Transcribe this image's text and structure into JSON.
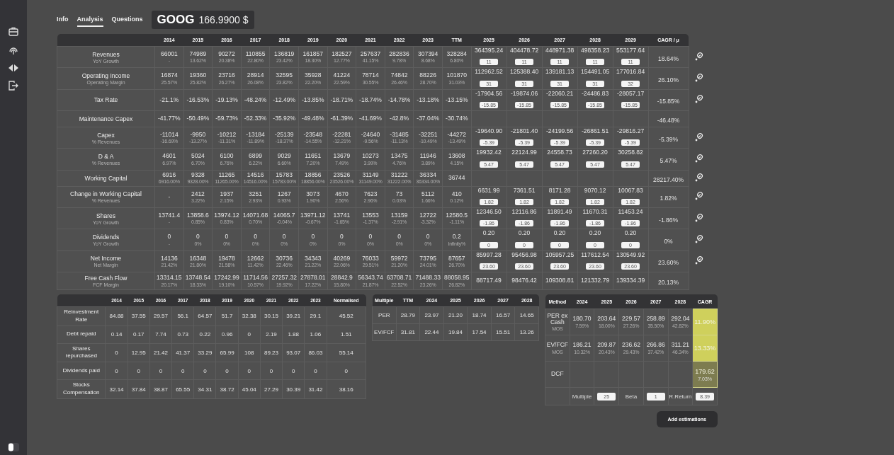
{
  "tabs": [
    {
      "label": "Info",
      "selected": false
    },
    {
      "label": "Analysis",
      "selected": true
    },
    {
      "label": "Questions",
      "selected": false
    }
  ],
  "quote": {
    "ticker": "GOOG",
    "price": "166.9900 $"
  },
  "main_table": {
    "history_columns": [
      "2014",
      "2015",
      "2016",
      "2017",
      "2018",
      "2019",
      "2020",
      "2021",
      "2022",
      "2023",
      "TTM"
    ],
    "forecast_columns": [
      "2025",
      "2026",
      "2027",
      "2028",
      "2029"
    ],
    "cagr_column": "CAGR / μ",
    "rows": [
      {
        "label": "Revenues",
        "sublabel": "YoY Growth",
        "history": [
          {
            "value": "66001",
            "sub": "-"
          },
          {
            "value": "74989",
            "sub": "13.62%"
          },
          {
            "value": "90272",
            "sub": "20.38%"
          },
          {
            "value": "110855",
            "sub": "22.80%"
          },
          {
            "value": "136819",
            "sub": "23.42%"
          },
          {
            "value": "161857",
            "sub": "18.30%"
          },
          {
            "value": "182527",
            "sub": "12.77%"
          },
          {
            "value": "257637",
            "sub": "41.15%"
          },
          {
            "value": "282836",
            "sub": "9.78%"
          },
          {
            "value": "307394",
            "sub": "8.68%"
          },
          {
            "value": "328284",
            "sub": "6.80%"
          }
        ],
        "forecast": [
          {
            "value": "364395.24",
            "input": "11"
          },
          {
            "value": "404478.72",
            "input": "11"
          },
          {
            "value": "448971.38",
            "input": "11"
          },
          {
            "value": "498358.23",
            "input": "11"
          },
          {
            "value": "553177.64",
            "input": "11"
          }
        ],
        "cagr": "18.64%",
        "editable": true
      },
      {
        "label": "Operating Income",
        "sublabel": "Operating Margin",
        "history": [
          {
            "value": "16874",
            "sub": "25.57%"
          },
          {
            "value": "19360",
            "sub": "25.82%"
          },
          {
            "value": "23716",
            "sub": "26.27%"
          },
          {
            "value": "28914",
            "sub": "26.08%"
          },
          {
            "value": "32595",
            "sub": "23.82%"
          },
          {
            "value": "35928",
            "sub": "22.20%"
          },
          {
            "value": "41224",
            "sub": "22.59%"
          },
          {
            "value": "78714",
            "sub": "30.55%"
          },
          {
            "value": "74842",
            "sub": "26.46%"
          },
          {
            "value": "88226",
            "sub": "28.70%"
          },
          {
            "value": "101870",
            "sub": "31.03%"
          }
        ],
        "forecast": [
          {
            "value": "112962.52",
            "input": "31"
          },
          {
            "value": "125388.40",
            "input": "31"
          },
          {
            "value": "139181.13",
            "input": "31"
          },
          {
            "value": "154491.05",
            "input": "31"
          },
          {
            "value": "177016.84",
            "input": "32"
          }
        ],
        "cagr": "26.10%",
        "editable": true
      },
      {
        "label": "Tax Rate",
        "history": [
          {
            "value": "-21.1%"
          },
          {
            "value": "-16.53%"
          },
          {
            "value": "-19.13%"
          },
          {
            "value": "-48.24%"
          },
          {
            "value": "-12.49%"
          },
          {
            "value": "-13.85%"
          },
          {
            "value": "-18.71%"
          },
          {
            "value": "-18.74%"
          },
          {
            "value": "-14.78%"
          },
          {
            "value": "-13.18%"
          },
          {
            "value": "-13.15%"
          }
        ],
        "forecast": [
          {
            "value": "-17904.56",
            "input": "-15.85"
          },
          {
            "value": "-19874.06",
            "input": "-15.85"
          },
          {
            "value": "-22060.21",
            "input": "-15.85"
          },
          {
            "value": "-24486.83",
            "input": "-15.85"
          },
          {
            "value": "-28057.17",
            "input": "-15.85"
          }
        ],
        "cagr": "-15.85%",
        "editable": true
      },
      {
        "label": "Maintenance Capex",
        "history": [
          {
            "value": "-41.77%"
          },
          {
            "value": "-50.49%"
          },
          {
            "value": "-59.73%"
          },
          {
            "value": "-52.33%"
          },
          {
            "value": "-35.92%"
          },
          {
            "value": "-49.48%"
          },
          {
            "value": "-61.39%"
          },
          {
            "value": "-41.69%"
          },
          {
            "value": "-42.8%"
          },
          {
            "value": "-37.04%"
          },
          {
            "value": "-30.74%"
          }
        ],
        "cagr": "-46.48%",
        "editable": false
      },
      {
        "label": "Capex",
        "sublabel": "% Revenues",
        "history": [
          {
            "value": "-11014",
            "sub": "-16.69%"
          },
          {
            "value": "-9950",
            "sub": "-13.27%"
          },
          {
            "value": "-10212",
            "sub": "-11.31%"
          },
          {
            "value": "-13184",
            "sub": "-11.89%"
          },
          {
            "value": "-25139",
            "sub": "-18.37%"
          },
          {
            "value": "-23548",
            "sub": "-14.55%"
          },
          {
            "value": "-22281",
            "sub": "-12.21%"
          },
          {
            "value": "-24640",
            "sub": "-9.56%"
          },
          {
            "value": "-31485",
            "sub": "-11.13%"
          },
          {
            "value": "-32251",
            "sub": "-10.49%"
          },
          {
            "value": "-44272",
            "sub": "-13.49%"
          }
        ],
        "forecast": [
          {
            "value": "-19640.90",
            "input": "-5.39"
          },
          {
            "value": "-21801.40",
            "input": "-5.39"
          },
          {
            "value": "-24199.56",
            "input": "-5.39"
          },
          {
            "value": "-26861.51",
            "input": "-5.39"
          },
          {
            "value": "-29816.27",
            "input": "-5.39"
          }
        ],
        "cagr": "-5.39%",
        "editable": true
      },
      {
        "label": "D & A",
        "sublabel": "% Revenues",
        "history": [
          {
            "value": "4601",
            "sub": "6.97%"
          },
          {
            "value": "5024",
            "sub": "6.70%"
          },
          {
            "value": "6100",
            "sub": "6.76%"
          },
          {
            "value": "6899",
            "sub": "6.22%"
          },
          {
            "value": "9029",
            "sub": "6.60%"
          },
          {
            "value": "11651",
            "sub": "7.20%"
          },
          {
            "value": "13679",
            "sub": "7.49%"
          },
          {
            "value": "10273",
            "sub": "3.99%"
          },
          {
            "value": "13475",
            "sub": "4.76%"
          },
          {
            "value": "11946",
            "sub": "3.89%"
          },
          {
            "value": "13608",
            "sub": "4.15%"
          }
        ],
        "forecast": [
          {
            "value": "19932.42",
            "input": "5.47"
          },
          {
            "value": "22124.99",
            "input": "5.47"
          },
          {
            "value": "24558.73",
            "input": "5.47"
          },
          {
            "value": "27260.20",
            "input": "5.47"
          },
          {
            "value": "30258.82",
            "input": "5.47"
          }
        ],
        "cagr": "5.47%",
        "editable": true
      },
      {
        "label": "Working Capital",
        "history": [
          {
            "value": "6916",
            "sub": "6916.00%"
          },
          {
            "value": "9328",
            "sub": "9328.00%"
          },
          {
            "value": "11265",
            "sub": "11265.00%"
          },
          {
            "value": "14516",
            "sub": "14516.00%"
          },
          {
            "value": "15783",
            "sub": "15783.00%"
          },
          {
            "value": "18856",
            "sub": "18856.00%"
          },
          {
            "value": "23526",
            "sub": "23526.00%"
          },
          {
            "value": "31149",
            "sub": "31149.00%"
          },
          {
            "value": "31222",
            "sub": "31222.00%"
          },
          {
            "value": "36334",
            "sub": "36334.00%"
          },
          {
            "value": "36744"
          }
        ],
        "cagr": "28217.40%",
        "editable": true
      },
      {
        "label": "Change in Working Capital",
        "sublabel": "% Revenues",
        "history": [
          {
            "value": "-"
          },
          {
            "value": "2412",
            "sub": "3.22%"
          },
          {
            "value": "1937",
            "sub": "2.15%"
          },
          {
            "value": "3251",
            "sub": "2.93%"
          },
          {
            "value": "1267",
            "sub": "0.93%"
          },
          {
            "value": "3073",
            "sub": "1.90%"
          },
          {
            "value": "4670",
            "sub": "2.56%"
          },
          {
            "value": "7623",
            "sub": "2.96%"
          },
          {
            "value": "73",
            "sub": "0.03%"
          },
          {
            "value": "5112",
            "sub": "1.66%"
          },
          {
            "value": "410",
            "sub": "0.12%"
          }
        ],
        "forecast": [
          {
            "value": "6631.99",
            "input": "1.82"
          },
          {
            "value": "7361.51",
            "input": "1.82"
          },
          {
            "value": "8171.28",
            "input": "1.82"
          },
          {
            "value": "9070.12",
            "input": "1.82"
          },
          {
            "value": "10067.83",
            "input": "1.82"
          }
        ],
        "cagr": "1.82%",
        "editable": true
      },
      {
        "label": "Shares",
        "sublabel": "YoY Growth",
        "history": [
          {
            "value": "13741.4",
            "sub": "-"
          },
          {
            "value": "13858.6",
            "sub": "0.85%"
          },
          {
            "value": "13974.12",
            "sub": "0.83%"
          },
          {
            "value": "14071.68",
            "sub": "0.70%"
          },
          {
            "value": "14065.7",
            "sub": "-0.04%"
          },
          {
            "value": "13971.12",
            "sub": "-0.67%"
          },
          {
            "value": "13741",
            "sub": "-1.65%"
          },
          {
            "value": "13553",
            "sub": "-1.37%"
          },
          {
            "value": "13159",
            "sub": "-2.91%"
          },
          {
            "value": "12722",
            "sub": "-3.32%"
          },
          {
            "value": "12580.5",
            "sub": "-1.11%"
          }
        ],
        "forecast": [
          {
            "value": "12346.50",
            "input": "-1.86"
          },
          {
            "value": "12116.86",
            "input": "-1.86"
          },
          {
            "value": "11891.49",
            "input": "-1.86"
          },
          {
            "value": "11670.31",
            "input": "-1.86"
          },
          {
            "value": "11453.24",
            "input": "-1.86"
          }
        ],
        "cagr": "-1.86%",
        "editable": true
      },
      {
        "label": "Dividends",
        "sublabel": "YoY Growth",
        "history": [
          {
            "value": "0",
            "sub": "-"
          },
          {
            "value": "0",
            "sub": "0%"
          },
          {
            "value": "0",
            "sub": "0%"
          },
          {
            "value": "0",
            "sub": "0%"
          },
          {
            "value": "0",
            "sub": "0%"
          },
          {
            "value": "0",
            "sub": "0%"
          },
          {
            "value": "0",
            "sub": "0%"
          },
          {
            "value": "0",
            "sub": "0%"
          },
          {
            "value": "0",
            "sub": "0%"
          },
          {
            "value": "0",
            "sub": "0%"
          },
          {
            "value": "0.2",
            "sub": "Infinity%"
          }
        ],
        "forecast": [
          {
            "value": "0.20",
            "input": "0"
          },
          {
            "value": "0.20",
            "input": "0"
          },
          {
            "value": "0.20",
            "input": "0"
          },
          {
            "value": "0.20",
            "input": "0"
          },
          {
            "value": "0.20",
            "input": "0"
          }
        ],
        "cagr": "0%",
        "editable": true
      },
      {
        "label": "Net Income",
        "sublabel": "Net Margin",
        "history": [
          {
            "value": "14136",
            "sub": "21.42%"
          },
          {
            "value": "16348",
            "sub": "21.80%"
          },
          {
            "value": "19478",
            "sub": "21.58%"
          },
          {
            "value": "12662",
            "sub": "11.42%"
          },
          {
            "value": "30736",
            "sub": "22.46%"
          },
          {
            "value": "34343",
            "sub": "21.22%"
          },
          {
            "value": "40269",
            "sub": "22.06%"
          },
          {
            "value": "76033",
            "sub": "29.51%"
          },
          {
            "value": "59972",
            "sub": "21.20%"
          },
          {
            "value": "73795",
            "sub": "24.01%"
          },
          {
            "value": "87657",
            "sub": "26.70%"
          }
        ],
        "forecast": [
          {
            "value": "85997.28",
            "input": "23.60"
          },
          {
            "value": "95456.98",
            "input": "23.60"
          },
          {
            "value": "105957.25",
            "input": "23.60"
          },
          {
            "value": "117612.54",
            "input": "23.60"
          },
          {
            "value": "130549.92",
            "input": "23.60"
          }
        ],
        "cagr": "23.60%",
        "editable": true
      },
      {
        "label": "Free Cash Flow",
        "sublabel": "FCF Margin",
        "history": [
          {
            "value": "13314.15",
            "sub": "20.17%"
          },
          {
            "value": "13748.54",
            "sub": "18.33%"
          },
          {
            "value": "17242.99",
            "sub": "19.10%"
          },
          {
            "value": "11714.56",
            "sub": "10.57%"
          },
          {
            "value": "27257.32",
            "sub": "19.92%"
          },
          {
            "value": "27878.01",
            "sub": "17.22%"
          },
          {
            "value": "28842.9",
            "sub": "15.80%"
          },
          {
            "value": "56343.74",
            "sub": "21.87%"
          },
          {
            "value": "63708.71",
            "sub": "22.52%"
          },
          {
            "value": "71488.33",
            "sub": "23.26%"
          },
          {
            "value": "88058.95",
            "sub": "26.82%"
          }
        ],
        "forecast": [
          {
            "value": "88717.49"
          },
          {
            "value": "98476.42"
          },
          {
            "value": "109308.81"
          },
          {
            "value": "121332.79"
          },
          {
            "value": "139334.39"
          }
        ],
        "cagr": "20.13%",
        "editable": false
      }
    ]
  },
  "ratios_table": {
    "columns": [
      "2014",
      "2015",
      "2016",
      "2017",
      "2018",
      "2019",
      "2020",
      "2021",
      "2022",
      "2023",
      "Normalised"
    ],
    "rows": [
      {
        "label": "Reinvestment Rate",
        "values": [
          "84.88",
          "37.55",
          "29.57",
          "56.1",
          "64.57",
          "51.7",
          "32.38",
          "30.15",
          "39.21",
          "29.1",
          "45.52"
        ]
      },
      {
        "label": "Debt repaid",
        "values": [
          "0.14",
          "0.17",
          "7.74",
          "0.73",
          "0.22",
          "0.96",
          "0",
          "2.19",
          "1.88",
          "1.06",
          "1.51"
        ]
      },
      {
        "label": "Shares repurchased",
        "values": [
          "0",
          "12.95",
          "21.42",
          "41.37",
          "33.29",
          "65.99",
          "108",
          "89.23",
          "93.07",
          "86.03",
          "55.14"
        ]
      },
      {
        "label": "Dividends paid",
        "values": [
          "0",
          "0",
          "0",
          "0",
          "0",
          "0",
          "0",
          "0",
          "0",
          "0",
          "0"
        ]
      },
      {
        "label": "Stocks Compensation",
        "values": [
          "32.14",
          "37.84",
          "38.87",
          "65.55",
          "34.31",
          "38.72",
          "45.04",
          "27.29",
          "30.39",
          "31.42",
          "38.16"
        ]
      }
    ]
  },
  "multiples_table": {
    "columns": [
      "Multiple",
      "TTM",
      "2024",
      "2025",
      "2026",
      "2027",
      "2028"
    ],
    "rows": [
      {
        "label": "PER",
        "values": [
          "28.79",
          "23.97",
          "21.20",
          "18.74",
          "16.57",
          "14.65"
        ]
      },
      {
        "label": "EV/FCF",
        "values": [
          "31.81",
          "22.44",
          "19.84",
          "17.54",
          "15.51",
          "13.26"
        ]
      }
    ]
  },
  "valuation_table": {
    "columns": [
      "Method",
      "2024",
      "2025",
      "2026",
      "2027",
      "2028",
      "CAGR"
    ],
    "rows": [
      {
        "label": "PER ex Cash",
        "sublabel": "MOS",
        "cells": [
          {
            "value": "180.70",
            "sub": "7.59%"
          },
          {
            "value": "203.64",
            "sub": "18.00%"
          },
          {
            "value": "229.57",
            "sub": "27.26%"
          },
          {
            "value": "258.89",
            "sub": "35.50%"
          },
          {
            "value": "292.04",
            "sub": "42.82%"
          }
        ],
        "cagr": {
          "value": "11.90%",
          "color": "#cfd05c"
        }
      },
      {
        "label": "EV/FCF",
        "sublabel": "MOS",
        "cells": [
          {
            "value": "186.21",
            "sub": "10.32%"
          },
          {
            "value": "209.87",
            "sub": "20.43%"
          },
          {
            "value": "236.62",
            "sub": "29.43%"
          },
          {
            "value": "266.86",
            "sub": "37.42%"
          },
          {
            "value": "311.21",
            "sub": "46.34%"
          }
        ],
        "cagr": {
          "value": "13.33%",
          "color": "#cfd05c"
        }
      },
      {
        "label": "DCF",
        "cagr": {
          "value": "179.62",
          "sub": "7.03%",
          "color": "#7d7c50"
        }
      }
    ],
    "parameters": [
      {
        "label": "Multiple",
        "value": "25"
      },
      {
        "label": "Beta",
        "value": "1"
      },
      {
        "label": "R.Return",
        "value": "8.39"
      }
    ]
  },
  "button": "Add estimations"
}
